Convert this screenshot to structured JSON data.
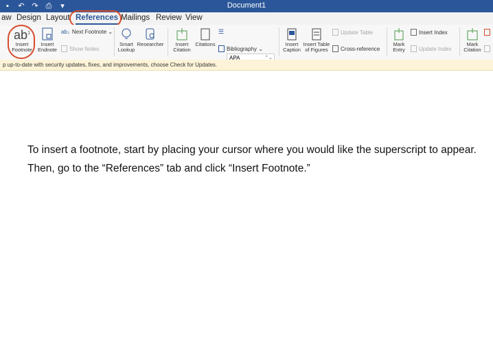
{
  "window": {
    "title": "Document1"
  },
  "qat": {
    "icons": [
      "save-icon",
      "undo-icon",
      "redo-icon",
      "print-icon",
      "customize-icon"
    ]
  },
  "tabs": [
    {
      "label": "aw"
    },
    {
      "label": "Design"
    },
    {
      "label": "Layout"
    },
    {
      "label": "References",
      "active": true
    },
    {
      "label": "Mailings"
    },
    {
      "label": "Review"
    },
    {
      "label": "View"
    }
  ],
  "ribbon": {
    "insert_footnote": {
      "line1": "Insert",
      "line2": "Footnote",
      "glyph": "ab",
      "sup": "1"
    },
    "insert_endnote": {
      "line1": "Insert",
      "line2": "Endnote"
    },
    "next_footnote": "Next Footnote ⌄",
    "show_notes": "Show Notes",
    "smart_lookup": {
      "line1": "Smart",
      "line2": "Lookup"
    },
    "researcher": "Researcher",
    "insert_citation": {
      "line1": "Insert",
      "line2": "Citation"
    },
    "citations": "Citations",
    "style": "APA",
    "bibliography": "Bibliography ⌄",
    "insert_caption": {
      "line1": "Insert",
      "line2": "Caption"
    },
    "insert_table_figures": {
      "line1": "Insert Table",
      "line2": "of Figures"
    },
    "update_table": "Update Table",
    "cross_reference": "Cross-reference",
    "mark_entry": {
      "line1": "Mark",
      "line2": "Entry"
    },
    "insert_index": "Insert Index",
    "update_index": "Update Index",
    "mark_citation": {
      "line1": "Mark",
      "line2": "Citation"
    }
  },
  "message_bar": {
    "text": "p up-to-date with security updates, fixes, and improvements, choose Check for Updates."
  },
  "document": {
    "paragraph": "To insert a footnote, start by placing your cursor where you would like the superscript to appear. Then, go to the “References” tab and click “Insert Footnote.”"
  },
  "colors": {
    "title_bar": "#2b579a",
    "annotation": "#d64b2a",
    "message_bar": "#fdf3d8"
  }
}
